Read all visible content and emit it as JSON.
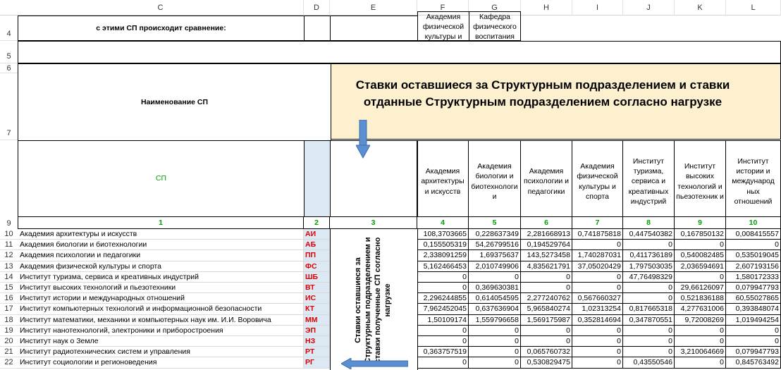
{
  "columns": [
    "C",
    "D",
    "E",
    "F",
    "G",
    "H",
    "I",
    "J",
    "K",
    "L"
  ],
  "row_numbers": {
    "r4": "4",
    "r5": "5",
    "r6": "6",
    "r7": "7",
    "r9": "9"
  },
  "compare_label": "с этими СП происходит сравнение:",
  "compare_units": [
    "Академия физической культуры и спорта",
    "Кафедра физического воспитания"
  ],
  "name_header": "Наименование СП",
  "banner": "Ставки оставшиеся за Структурным подразделением и ставки отданные Структурным подразделением согласно нагрузке",
  "sp_label": "СП",
  "unit_headers": [
    "Академия архитектуры и искусств",
    "Академия биологии и биотехнологи и",
    "Академия психологии и педагогики",
    "Академия физической культуры и спорта",
    "Институт туризма, сервиса и креативных индустрий",
    "Институт высоких технологий и пьезотехник и",
    "Институт истории и международ ных отношений"
  ],
  "index_row": [
    "1",
    "2",
    "3",
    "4",
    "5",
    "6",
    "7",
    "8",
    "9",
    "10"
  ],
  "vertical_note": "Ставки оставшиеся за Структурным подразделением и ставки полученные СП согласно нагрузке",
  "rows": [
    {
      "n": "10",
      "name": "Академия архитектуры и искусств",
      "code": "АИ",
      "v": [
        "108,3703665",
        "0,228637349",
        "2,281668913",
        "0,741875818",
        "0,447540382",
        "0,167850132",
        "0,008415557"
      ]
    },
    {
      "n": "11",
      "name": "Академия биологии и биотехнологии",
      "code": "АБ",
      "v": [
        "0,155505319",
        "54,26799516",
        "0,194529764",
        "0",
        "0",
        "0",
        "0"
      ]
    },
    {
      "n": "12",
      "name": "Академия психологии и педагогики",
      "code": "ПП",
      "v": [
        "2,338091259",
        "1,69375637",
        "143,5273458",
        "1,740287031",
        "0,411736189",
        "0,540082485",
        "0,535019045"
      ]
    },
    {
      "n": "13",
      "name": "Академия физической культуры и спорта",
      "code": "ФС",
      "v": [
        "5,162466453",
        "2,010749906",
        "4,835621791",
        "37,05020429",
        "1,797503035",
        "2,036594691",
        "2,607193156"
      ]
    },
    {
      "n": "14",
      "name": "Институт туризма, сервиса и креативных индустрий",
      "code": "ШБ",
      "v": [
        "0",
        "0",
        "0",
        "0",
        "47,76498329",
        "0",
        "1,580172333"
      ]
    },
    {
      "n": "15",
      "name": "Институт высоких технологий и пьезотехники",
      "code": "ВТ",
      "v": [
        "0",
        "0,369630381",
        "0",
        "0",
        "0",
        "29,66126097",
        "0,079947793"
      ]
    },
    {
      "n": "16",
      "name": "Институт истории и международных отношений",
      "code": "ИС",
      "v": [
        "2,296244855",
        "0,614054595",
        "2,277240762",
        "0,567660327",
        "0",
        "0,521836188",
        "60,55027865"
      ]
    },
    {
      "n": "17",
      "name": "Институт компьютерных технологий и информационной безопасности",
      "code": "КТ",
      "v": [
        "7,962452045",
        "0,637636904",
        "5,965840274",
        "1,02313254",
        "0,817665318",
        "4,277631006",
        "0,393848074"
      ]
    },
    {
      "n": "18",
      "name": "Институт математики, механики и компьютерных наук им. И.И. Воровича",
      "code": "ММ",
      "v": [
        "1,50109174",
        "1,559796658",
        "1,569175987",
        "0,352814694",
        "0,347870551",
        "9,72008269",
        "1,019494254"
      ]
    },
    {
      "n": "19",
      "name": "Институт нанотехнологий, электроники и приборостроения",
      "code": "ЭП",
      "v": [
        "0",
        "0",
        "0",
        "0",
        "0",
        "0",
        "0"
      ]
    },
    {
      "n": "20",
      "name": "Институт наук о Земле",
      "code": "НЗ",
      "v": [
        "0",
        "0",
        "0",
        "0",
        "0",
        "0",
        "0"
      ]
    },
    {
      "n": "21",
      "name": "Институт радиотехнических систем и управления",
      "code": "РТ",
      "v": [
        "0,363757519",
        "0",
        "0,065760732",
        "0",
        "0",
        "3,210064669",
        "0,079947793"
      ]
    },
    {
      "n": "22",
      "name": "Институт социологии и регионоведения",
      "code": "РГ",
      "v": [
        "0",
        "0",
        "0,530829475",
        "0",
        "0,43550546",
        "0",
        "0,845763492"
      ]
    }
  ],
  "colors": {
    "banner_bg": "#fdf0cf",
    "arrow": "#5b8fd1",
    "code_red": "#e00000",
    "index_green": "#00a000",
    "d_col_bg": "#dce9f5"
  },
  "icons": [
    "arrow-down-icon",
    "arrow-left-icon"
  ]
}
